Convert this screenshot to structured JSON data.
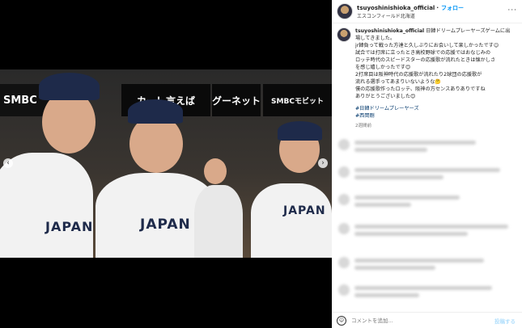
{
  "post": {
    "username": "tsuyoshinishioka_official",
    "follow_label": "フォロー",
    "location": "エスコンフィールド北海道",
    "more_label": "···",
    "caption_user": "tsuyoshinishioka_official",
    "caption_lines": [
      "日韓ドリームプレーヤーズゲームに出",
      "場してきました。",
      "jr韓負って戦った方達と久しぶりにお会いして楽しかったです☺",
      "試合では打席に立ったとき高校野球での応援ではおなじみの",
      "ロッテ時代のスピードスターの応援歌が流れたときは懐かしさ",
      "を感じ嬉しかったです😊",
      "2打席目は阪神時代の応援歌が流れたり2球団の応援歌が",
      "流れる選手ってあまりいないような🤔",
      "僕の応援歌作ったロッテ、阪神の方センスありありですね",
      "ありがとうございました😊"
    ],
    "hashtags": [
      "#日韓ドリームプレーヤーズ",
      "#西岡剛"
    ],
    "time_ago": "2週間前"
  },
  "photo": {
    "signs": [
      "SMBC",
      "カー！言えば",
      "グーネット",
      "SMBCモビット"
    ],
    "jersey_text": "JAPAN"
  },
  "comment_box": {
    "emoji_icon": "☺",
    "placeholder": "コメントを追加...",
    "post_label": "投稿する"
  }
}
